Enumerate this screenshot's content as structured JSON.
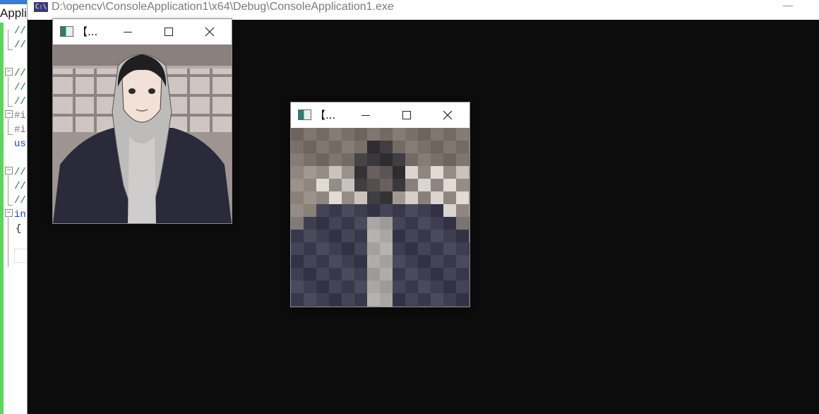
{
  "ide": {
    "title_fragment": "Applic",
    "lines": [
      {
        "text": "//",
        "cls": ""
      },
      {
        "text": "//",
        "cls": ""
      },
      {
        "text": "//",
        "cls": ""
      },
      {
        "text": "//",
        "cls": ""
      },
      {
        "text": "//",
        "cls": ""
      },
      {
        "text": "#i",
        "cls": "pp"
      },
      {
        "text": "#i",
        "cls": "pp"
      },
      {
        "text": "us",
        "cls": "kw"
      },
      {
        "text": "//",
        "cls": ""
      },
      {
        "text": "//",
        "cls": ""
      },
      {
        "text": "//",
        "cls": ""
      },
      {
        "text": "in",
        "cls": "kw"
      },
      {
        "text": "{",
        "cls": "br"
      }
    ]
  },
  "console": {
    "icon_text": "C:\\",
    "title": "D:\\opencv\\ConsoleApplication1\\x64\\Debug\\ConsoleApplication1.exe",
    "minimize_glyph": "—"
  },
  "windows": [
    {
      "id": "original",
      "title": "【...",
      "image": "anime-hoodie-portrait"
    },
    {
      "id": "mosaic",
      "title": "【...",
      "image": "pixelated-mosaic-portrait"
    }
  ],
  "colors": {
    "console_bg": "#0c0c0c",
    "ide_gutter": "#5fd35f",
    "title_text": "#7b7b7b"
  }
}
